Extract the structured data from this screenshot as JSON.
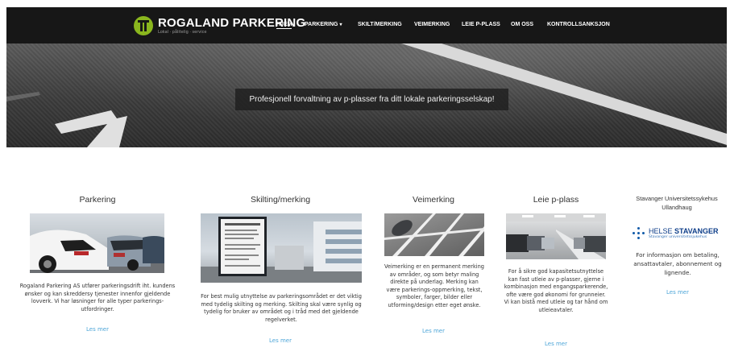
{
  "header": {
    "logo_title": "ROGALAND PARKERING",
    "logo_tagline": "Lokal · pålitelig · service",
    "nav": [
      {
        "label": "HJEM",
        "active": true
      },
      {
        "label": "PARKERING",
        "has_dropdown": true
      },
      {
        "label": "SKILT/MERKING"
      },
      {
        "label": "VEIMERKING"
      },
      {
        "label": "LEIE P-PLASS"
      },
      {
        "label": "OM OSS"
      },
      {
        "label": "KONTROLLSANKSJON"
      }
    ],
    "chevron_icon": "chevron-down-icon"
  },
  "hero": {
    "caption": "Profesjonell forvaltning av p-plasser fra ditt lokale parkeringsselskap!"
  },
  "columns": [
    {
      "title": "Parkering",
      "image": "parked-cars-photo",
      "text": "Rogaland Parkering AS utfører parkeringsdrift iht. kundens ønsker og kan skreddersy tjenester innenfor gjeldende lovverk. Vi har løsninger for alle typer parkerings-utfordringer.",
      "link": "Les mer"
    },
    {
      "title": "Skilting/merking",
      "image": "parking-sign-photo",
      "text": "For best mulig utnyttelse av parkeringsområdet er det viktig med tydelig skilting og merking. Skilting skal være synlig og tydelig for bruker av området og i tråd med det gjeldende regelverket.",
      "link": "Les mer"
    },
    {
      "title": "Veimerking",
      "image": "road-marking-photo",
      "text": "Veimerking er en permanent merking av områder, og som betyr maling direkte på underlag. Merking kan være parkerings-oppmerking, tekst, symboler, farger, bilder eller utforming/design etter eget ønske.",
      "link": "Les mer"
    },
    {
      "title": "Leie p-plass",
      "image": "parking-garage-photo",
      "text": "For å sikre god kapasitetsutnyttelse kan fast utleie av p-plasser, gjerne i kombinasjon med engangsparkerende, ofte være god økonomi for grunneier. Vi kan bistå med utleie og tar hånd om utleieavtaler.",
      "link": "Les mer"
    },
    {
      "title": "Stavanger Universitetssykehus Ullandhaug",
      "logo_name_light": "HELSE ",
      "logo_name_bold": "STAVANGER",
      "logo_sub": "Stavanger universitetssjukehus",
      "text": "For informasjon om betaling, ansattavtaler, abonnement og lignende.",
      "link": "Les mer"
    }
  ],
  "colors": {
    "header_bg": "#171717",
    "link": "#4ea6d8",
    "logo_green": "#8ab61e",
    "helse_blue": "#0f3f8a"
  }
}
